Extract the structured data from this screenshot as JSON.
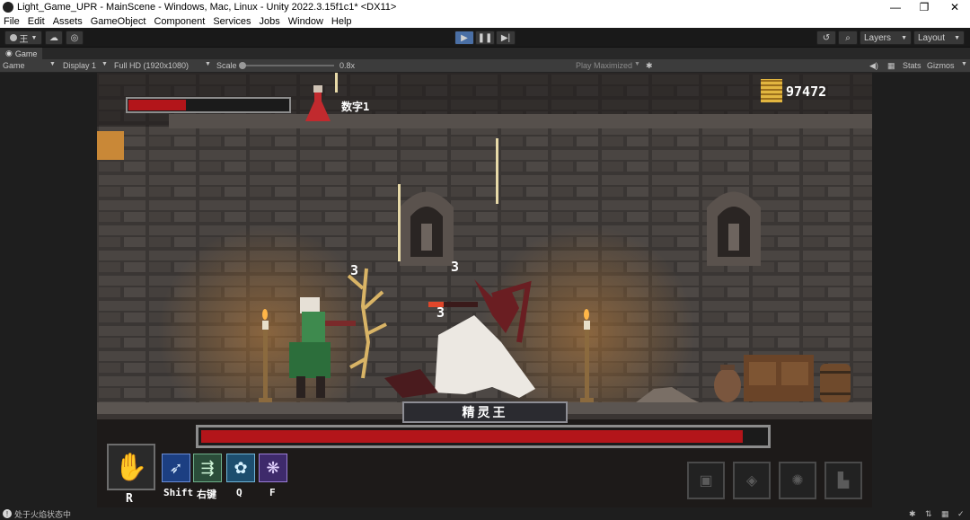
{
  "window": {
    "title": "Light_Game_UPR - MainScene - Windows, Mac, Linux - Unity 2022.3.15f1c1* <DX11>",
    "controls": {
      "minimize": "—",
      "maximize": "❐",
      "close": "✕"
    }
  },
  "menu": [
    "File",
    "Edit",
    "Assets",
    "GameObject",
    "Component",
    "Services",
    "Jobs",
    "Window",
    "Help"
  ],
  "toolbar": {
    "account_label": "王",
    "layers_label": "Layers",
    "layout_label": "Layout"
  },
  "tab": {
    "label": "Game"
  },
  "gamebar": {
    "view_select": "Game",
    "display_select": "Display 1",
    "resolution_select": "Full HD (1920x1080)",
    "scale_label": "Scale",
    "scale_value": "0.8x",
    "play_maximized": "Play Maximized",
    "stats_label": "Stats",
    "gizmos_label": "Gizmos"
  },
  "hud": {
    "potion_label": "数字1",
    "coin_count": "97472",
    "player_health_fraction": 0.36,
    "boss_name": "精灵王",
    "boss_health_fraction": 0.96,
    "enemy_mini_health_fraction": 0.3,
    "damage_numbers": [
      "3",
      "3",
      "3"
    ],
    "skills": [
      {
        "key": "R",
        "icon": "ghost-hand-icon"
      },
      {
        "key": "Shift",
        "icon": "dash-icon"
      },
      {
        "key": "右键",
        "icon": "arrow-volley-icon"
      },
      {
        "key": "Q",
        "icon": "water-spirit-icon"
      },
      {
        "key": "F",
        "icon": "shadow-burst-icon"
      }
    ],
    "colors": {
      "health_red": "#b3151a",
      "gold": "#e2b640"
    }
  },
  "status": {
    "text": "处于火焰状态中"
  }
}
